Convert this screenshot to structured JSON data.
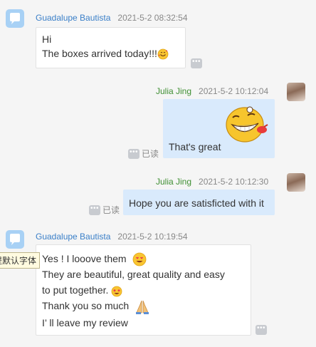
{
  "messages": [
    {
      "side": "left",
      "sender": "Guadalupe Bautista",
      "time": "2021-5-2 08:32:54",
      "lines": [
        "Hi",
        "The boxes arrived today!!!"
      ],
      "emoji": "smiling-face-with-hearts-emoji"
    },
    {
      "side": "right",
      "sender": "Julia Jing",
      "time": "2021-5-2 10:12:04",
      "text": "That's great",
      "sticker": "laughing-sticker",
      "read_status": "已读"
    },
    {
      "side": "right",
      "sender": "Julia Jing",
      "time": "2021-5-2 10:12:30",
      "text": "Hope you are satisficted with it",
      "read_status": "已读"
    },
    {
      "side": "left",
      "sender": "Guadalupe Bautista",
      "time": "2021-5-2 10:19:54",
      "lines": [
        "Yes ! I looove them",
        "They are beautiful, great quality and easy",
        "to put together.",
        "Thank you so much",
        "I’ ll leave my review"
      ]
    }
  ],
  "more_label": "•••",
  "tooltip": "提默认字体",
  "colors": {
    "background": "#f5f5f5",
    "left_name": "#3a7fc8",
    "right_name": "#3f8f33",
    "right_bubble": "#d9eafc"
  }
}
